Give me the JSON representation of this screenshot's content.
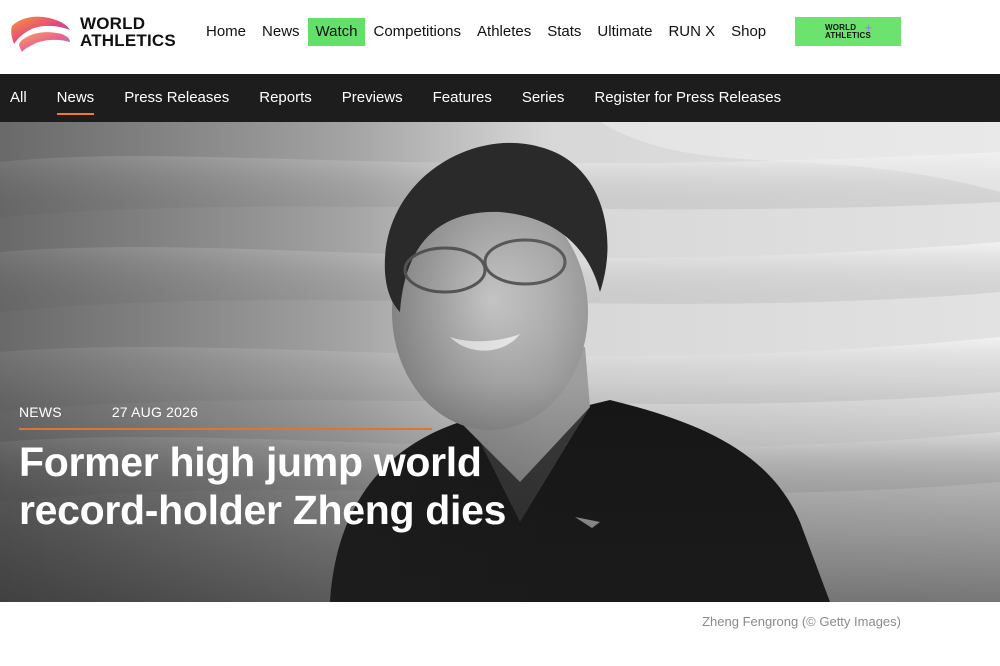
{
  "brand": {
    "line1": "WORLD",
    "line2": "ATHLETICS"
  },
  "nav": {
    "items": [
      {
        "label": "Home"
      },
      {
        "label": "News"
      },
      {
        "label": "Watch",
        "active": true
      },
      {
        "label": "Competitions"
      },
      {
        "label": "Athletes"
      },
      {
        "label": "Stats"
      },
      {
        "label": "Ultimate"
      },
      {
        "label": "RUN X"
      },
      {
        "label": "Shop"
      }
    ]
  },
  "badge": {
    "line1": "WORLD",
    "line2": "ATHLETICS",
    "plus": "+"
  },
  "subnav": {
    "items": [
      {
        "label": "All"
      },
      {
        "label": "News",
        "active": true
      },
      {
        "label": "Press Releases"
      },
      {
        "label": "Reports"
      },
      {
        "label": "Previews"
      },
      {
        "label": "Features"
      },
      {
        "label": "Series"
      },
      {
        "label": "Register for Press Releases"
      }
    ]
  },
  "article": {
    "category": "NEWS",
    "date": "27 AUG 2026",
    "headline_line1": "Former high jump world",
    "headline_line2": "record-holder Zheng dies",
    "caption": "Zheng Fengrong (© Getty Images)"
  },
  "colors": {
    "accent_green": "#63e06a",
    "subnav_bg": "#1d1d1d",
    "underline_orange": "#f07c2a"
  }
}
